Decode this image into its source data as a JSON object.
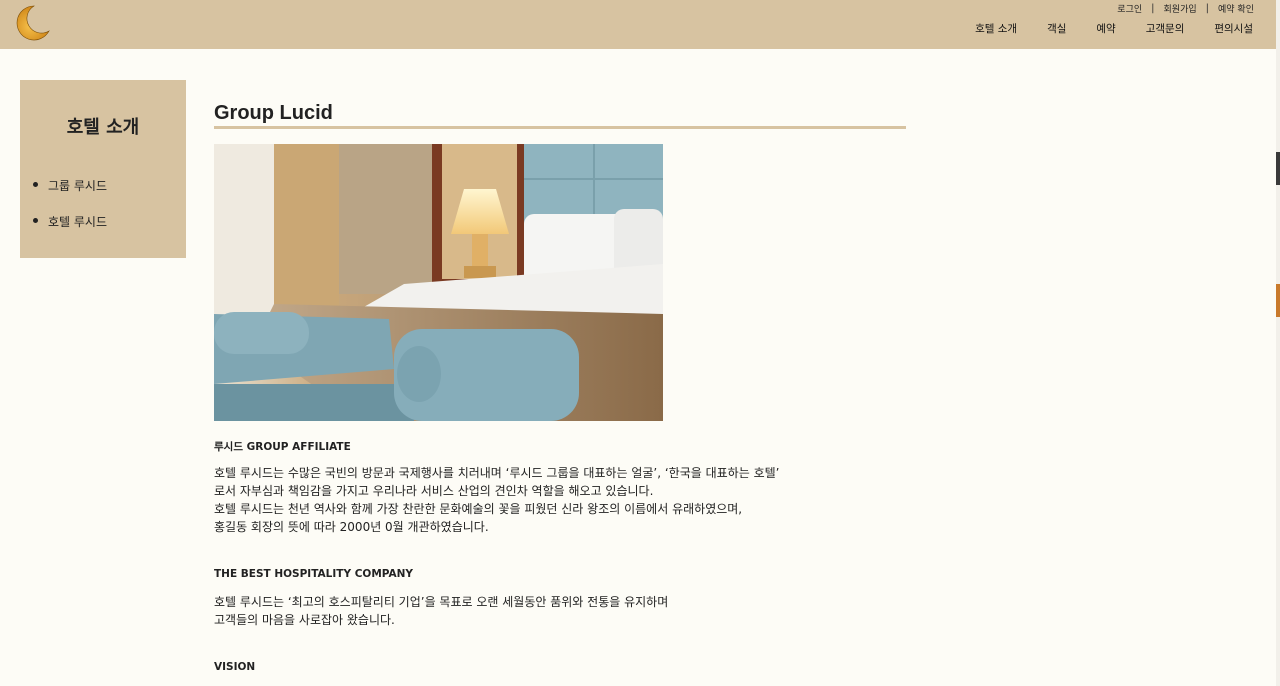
{
  "header": {
    "top_links": [
      "로그인",
      "회원가입",
      "예약 확인"
    ],
    "nav": [
      "호텔 소개",
      "객실",
      "예약",
      "고객문의",
      "편의시설"
    ],
    "logo_icon": "crescent-moon-icon"
  },
  "sidebar": {
    "title": "호텔 소개",
    "items": [
      "그룹 루시드",
      "호텔 루시드"
    ]
  },
  "main": {
    "title": "Group Lucid",
    "image_icon": "hotel-room-photo",
    "sections": [
      {
        "heading": "루시드 GROUP AFFILIATE",
        "lines": [
          "호텔 루시드는 수많은 국빈의 방문과 국제행사를 치러내며 ‘루시드 그룹을 대표하는 얼굴’, ‘한국을 대표하는 호텔’",
          "로서 자부심과 책임감을 가지고 우리나라 서비스 산업의 견인차 역할을 해오고 있습니다.",
          "호텔 루시드는 천년 역사와 함께 가장 찬란한 문화예술의 꽃을 피웠던 신라 왕조의 이름에서 유래하였으며,",
          "홍길동 회장의 뜻에 따라 2000년 0월 개관하였습니다."
        ]
      },
      {
        "heading": "THE BEST HOSPITALITY COMPANY",
        "lines": [
          "호텔 루시드는 ‘최고의 호스피탈리티 기업’을 목표로 오랜 세월동안 품위와 전통을 유지하며",
          "고객들의 마음을 사로잡아 왔습니다."
        ]
      },
      {
        "heading": "VISION",
        "lines": []
      }
    ]
  },
  "colors": {
    "header_bg": "#d7c3a1",
    "page_bg": "#fdfcf6",
    "accent_rule": "#d7c3a1",
    "moon": "#e8a317"
  }
}
